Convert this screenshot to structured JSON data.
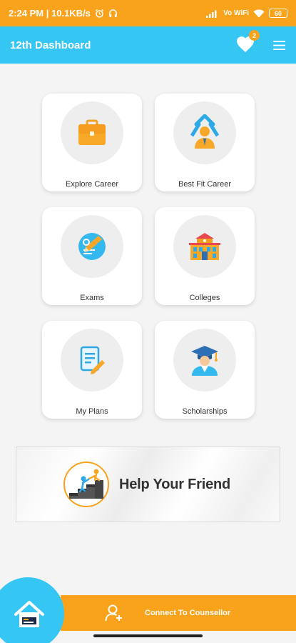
{
  "status_bar": {
    "time_speed": "2:24 PM | 10.1KB/s",
    "network": "Vo WiFi",
    "battery": "60"
  },
  "header": {
    "title": "12th Dashboard",
    "favorites_count": "2",
    "accent_color": "#35c6f4"
  },
  "tiles": [
    {
      "label": "Explore Career",
      "icon": "briefcase-icon"
    },
    {
      "label": "Best Fit Career",
      "icon": "career-growth-icon"
    },
    {
      "label": "Exams",
      "icon": "exam-pen-icon"
    },
    {
      "label": "Colleges",
      "icon": "college-building-icon"
    },
    {
      "label": "My Plans",
      "icon": "document-edit-icon"
    },
    {
      "label": "Scholarships",
      "icon": "graduate-icon"
    }
  ],
  "banner": {
    "text": "Help Your Friend",
    "icon": "helping-hand-icon"
  },
  "bottom": {
    "counsellor_label": "Connect To Counsellor",
    "home_icon": "home-icon",
    "brand_color": "#f9a21b"
  }
}
